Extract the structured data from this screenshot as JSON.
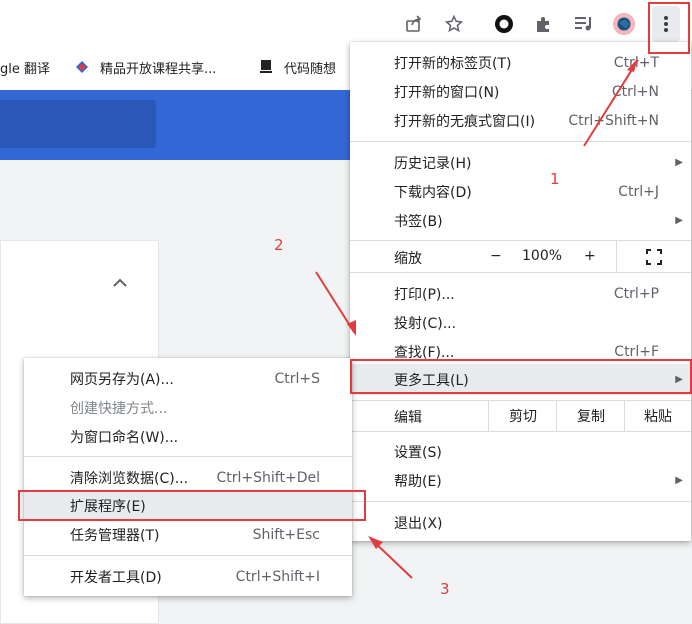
{
  "toolbar": {
    "icons": [
      "share-icon",
      "star-icon",
      "extension-circle-icon",
      "puzzle-icon",
      "media-control-icon",
      "profile-avatar",
      "more-menu-icon"
    ]
  },
  "bookmarks": [
    {
      "label": "gle 翻译"
    },
    {
      "label": "精品开放课程共享..."
    },
    {
      "label": "代码随想"
    }
  ],
  "main_menu": {
    "items1": [
      {
        "label": "打开新的标签页(T)",
        "shortcut": "Ctrl+T"
      },
      {
        "label": "打开新的窗口(N)",
        "shortcut": "Ctrl+N"
      },
      {
        "label": "打开新的无痕式窗口(I)",
        "shortcut": "Ctrl+Shift+N"
      }
    ],
    "items2": [
      {
        "label": "历史记录(H)",
        "shortcut": ""
      },
      {
        "label": "下载内容(D)",
        "shortcut": "Ctrl+J"
      },
      {
        "label": "书签(B)",
        "shortcut": ""
      }
    ],
    "zoom": {
      "label": "缩放",
      "minus": "−",
      "value": "100%",
      "plus": "+"
    },
    "items3": [
      {
        "label": "打印(P)...",
        "shortcut": "Ctrl+P"
      },
      {
        "label": "投射(C)...",
        "shortcut": ""
      },
      {
        "label": "查找(F)...",
        "shortcut": "Ctrl+F"
      },
      {
        "label": "更多工具(L)",
        "shortcut": ""
      }
    ],
    "edit": {
      "label": "编辑",
      "cut": "剪切",
      "copy": "复制",
      "paste": "粘贴"
    },
    "items4": [
      {
        "label": "设置(S)",
        "shortcut": ""
      },
      {
        "label": "帮助(E)",
        "shortcut": ""
      }
    ],
    "exit": {
      "label": "退出(X)"
    }
  },
  "sub_menu": {
    "group1": [
      {
        "label": "网页另存为(A)...",
        "shortcut": "Ctrl+S",
        "disabled": false
      },
      {
        "label": "创建快捷方式...",
        "shortcut": "",
        "disabled": true
      },
      {
        "label": "为窗口命名(W)...",
        "shortcut": "",
        "disabled": false
      }
    ],
    "group2": [
      {
        "label": "清除浏览数据(C)...",
        "shortcut": "Ctrl+Shift+Del"
      },
      {
        "label": "扩展程序(E)",
        "shortcut": ""
      },
      {
        "label": "任务管理器(T)",
        "shortcut": "Shift+Esc"
      }
    ],
    "group3": [
      {
        "label": "开发者工具(D)",
        "shortcut": "Ctrl+Shift+I"
      }
    ]
  },
  "annotations": {
    "step1": "1",
    "step2": "2",
    "step3": "3"
  },
  "colors": {
    "highlight": "#e03e3e",
    "accent": "#3367d6"
  }
}
